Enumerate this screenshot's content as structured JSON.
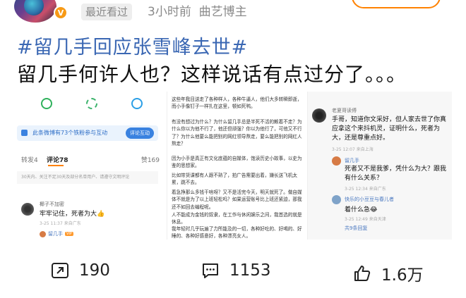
{
  "header": {
    "recent_badge": "最近看过",
    "time_ago": "3小时前",
    "role": "曲艺博主",
    "verified_badge": "V"
  },
  "post": {
    "topic": "#留几手回应张雪峰去世#",
    "text": "留几手何许人也？这样说话有点过分了。。。"
  },
  "screenshot": {
    "left": {
      "promo_text": "此条微博有73个铁粉参与互动",
      "promo_button": "评论互动",
      "tab_repost": "转发4",
      "tab_comment": "评论78",
      "tab_likes": "赞169",
      "notice": "30天内、关注不足30天及部分名单用户、请遵守文明评论",
      "comment_user": "椰子不加密",
      "comment_text": "牢牢记住，死者为大👍",
      "comment_time": "3-25 11:37 来自广东",
      "reply_user": "留几手",
      "reply_tag": "VIP"
    },
    "middle": {
      "p1": "这些年我目送走了各种样人，各种牛逼人，他们大多转瞬即逝，而小手像钉子一样扎在这里，顿如死鸭。",
      "p2": "有没有想过为什么？为什么留几手总是半死不活的赖着不走？为什么你以为他不行了，他还但顽强？你以为他行了，可他又不行了？为什么他要么能把别的网红领导熬走，要么能把别的网红人熬走？",
      "p3": "因为小手是真正有文化底蕴的自媒体，饱读历史小故事，以史为鉴的思想家。",
      "p4": "比如带货课都有人跟不熟了，拍广告需要出着，嫌长送飞机太累，跳不去。",
      "p5": "着急挣那么多钱干啥呀？又不是活完今天，明天就死了。做自媒体不就是为了以上班轻松吗？如果运营账号比上班还紧迫，那我还不如回去编程呢。",
      "p6": "人不能成为金钱的奴隶，在工作与休闲娱乐之间，我首选的就是休息。",
      "p7": "我年轻时几乎玩遍了力所能及的一切，各种好吃的、好喝的、好睡的、各种好感意好，各种漂亮女人。"
    },
    "right": {
      "comment_user": "老夏哥读傅",
      "comment_text": "手哥，知道你文采好，但人家去世了你真应拿这个来抖机灵，证明什么，死者为大，还是尊重点好。",
      "comment_time": "3-25 12:07 来自上海",
      "reply1_user": "留几手",
      "reply1_text": "死者又不是我爹，凭什么为大？跟我有什么关系？",
      "reply1_time": "3-25 12:34 来自广东",
      "reply2_user": "快乐的小豆豆与春儿者",
      "reply2_text": "着什么急😂",
      "reply2_time": "3-25 12:49 来自天津",
      "more": "共9条回复"
    }
  },
  "actions": {
    "reposts": "190",
    "comments": "1153",
    "likes": "1.6万"
  }
}
